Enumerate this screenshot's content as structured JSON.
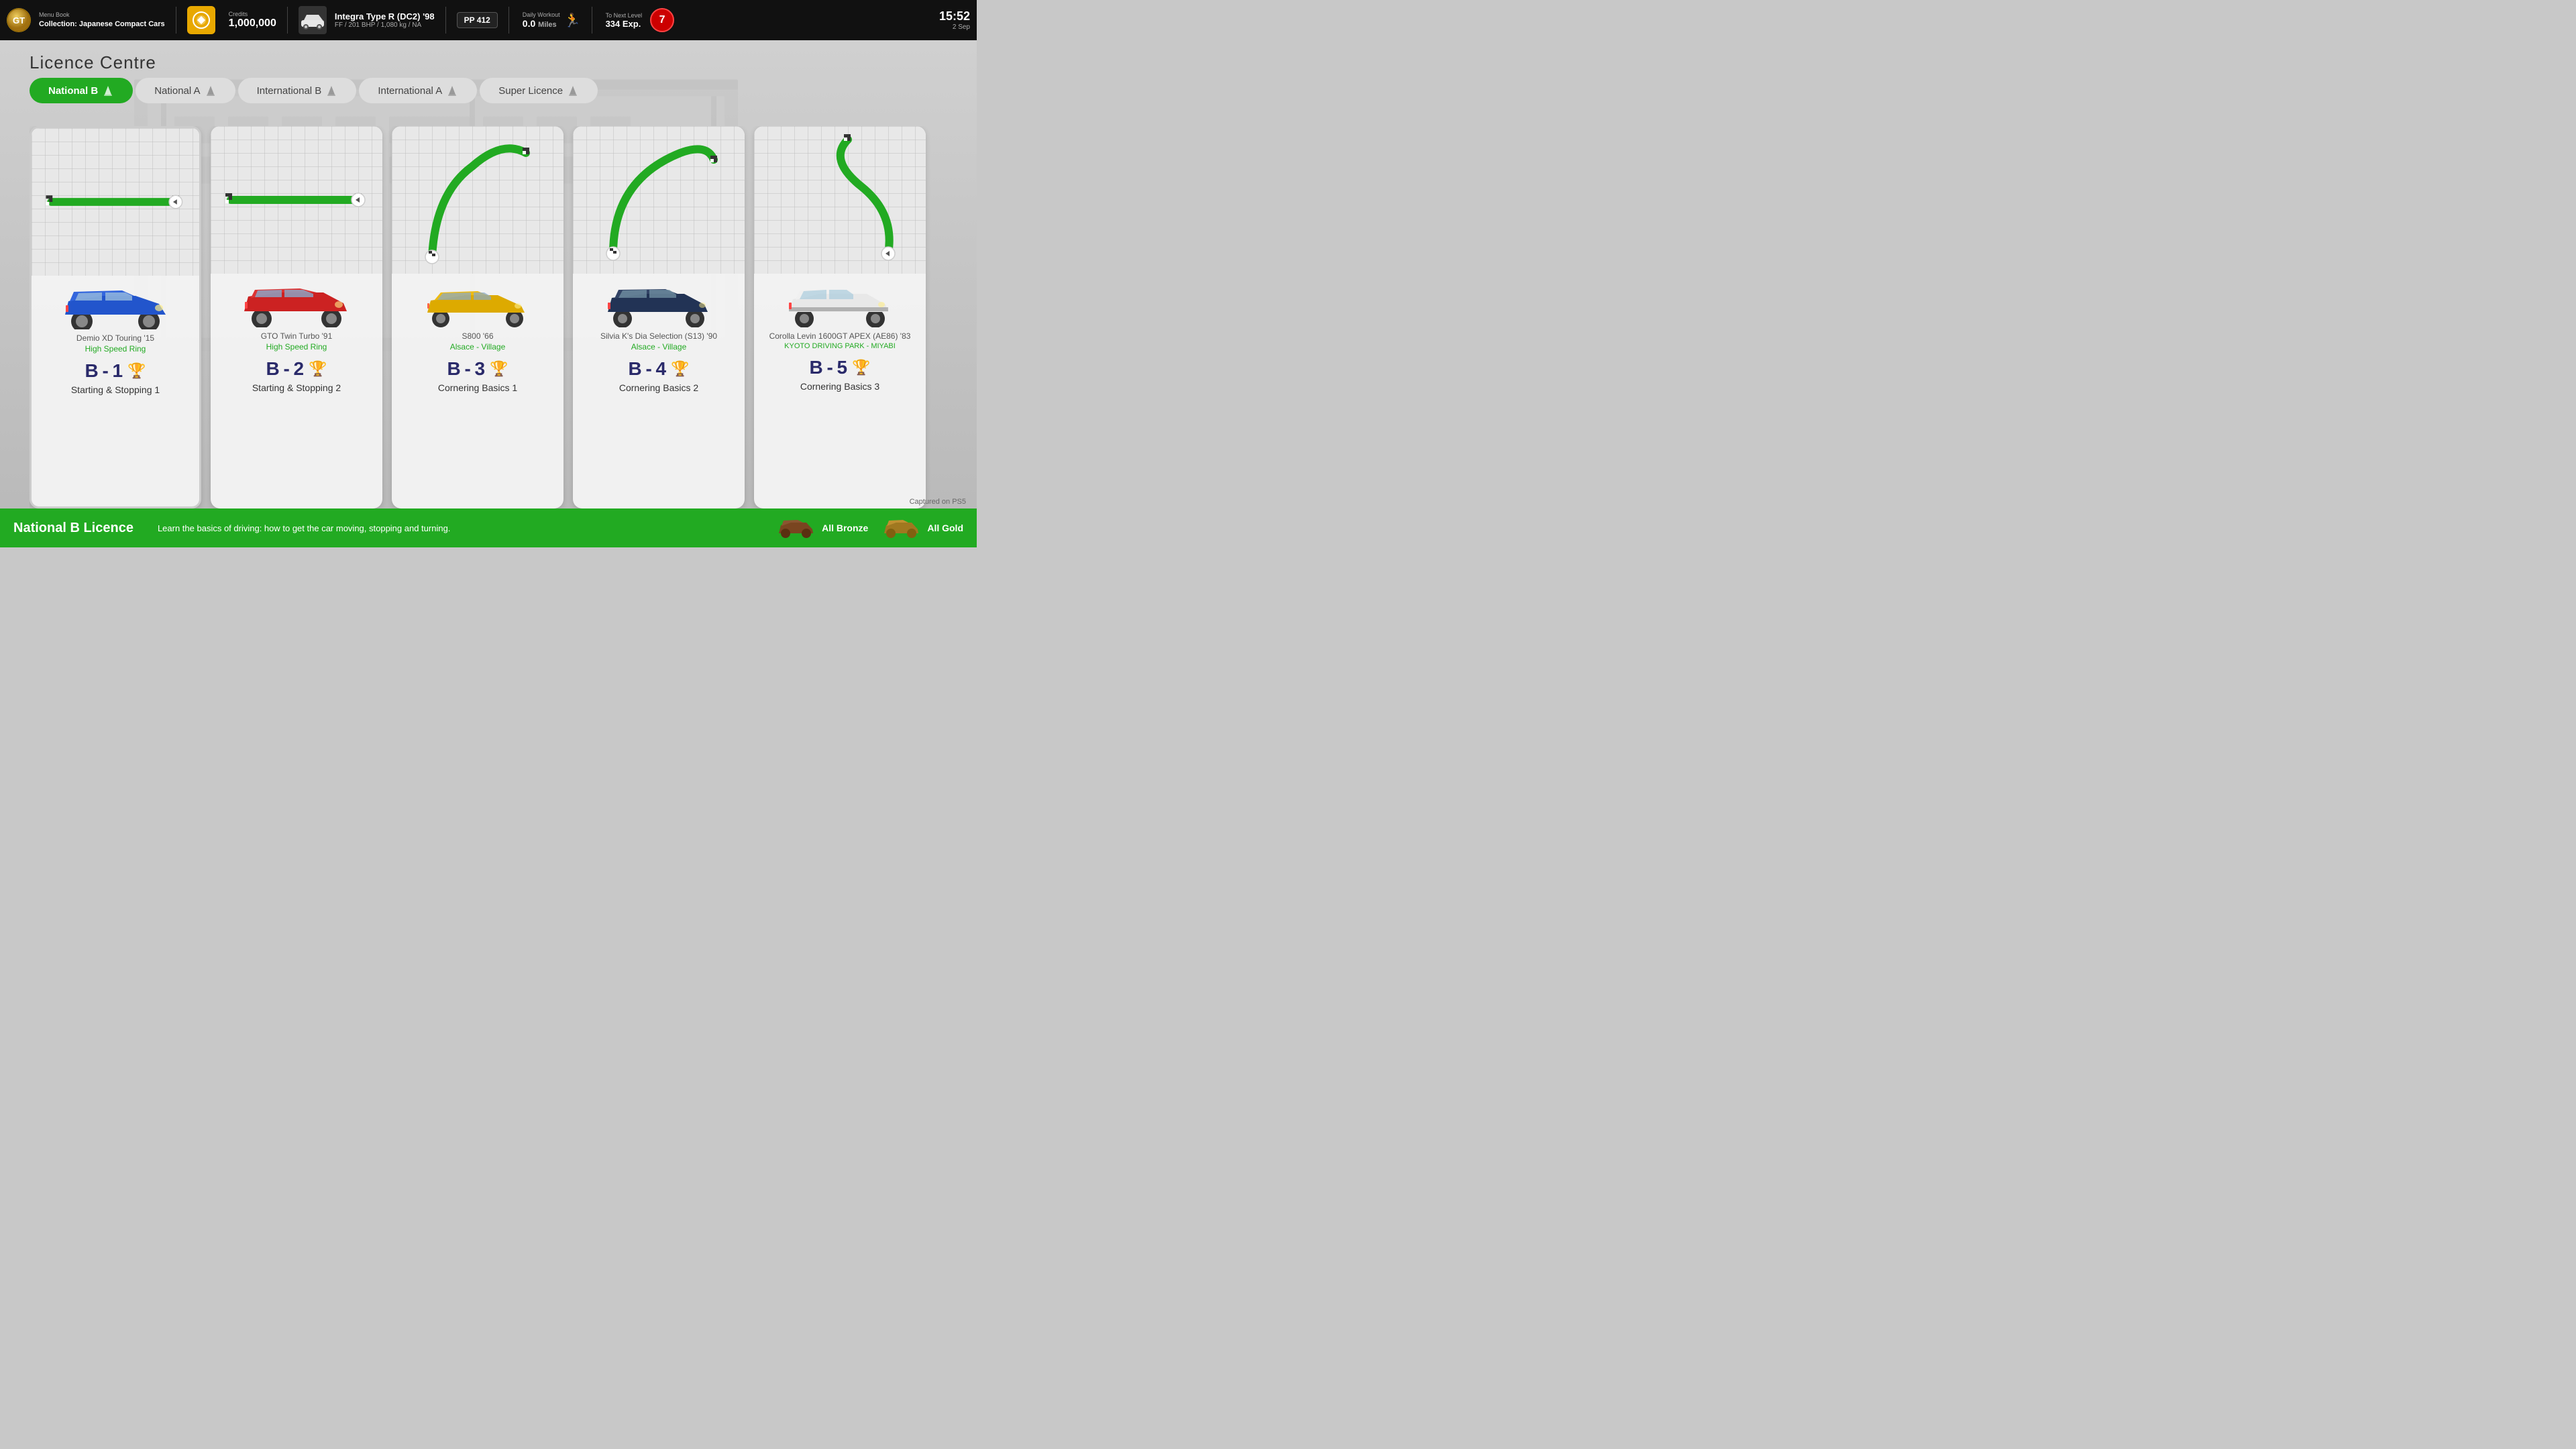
{
  "topbar": {
    "logo": "GT",
    "menu_label": "Menu Book",
    "collection": "Collection: Japanese Compact Cars",
    "credits_label": "Credits",
    "credits_amount": "1,000,000",
    "car_name": "Integra Type R (DC2) '98",
    "car_spec": "FF / 201 BHP / 1,080 kg / NA",
    "pp_label": "PP",
    "pp_value": "412",
    "workout_label": "Daily Workout",
    "workout_value": "0.0",
    "workout_unit": "Miles",
    "next_level_label": "To Next Level",
    "next_level_value": "334 Exp.",
    "level_number": "7",
    "time": "15:52",
    "date": "2 Sep"
  },
  "page": {
    "title": "Licence Centre"
  },
  "tabs": [
    {
      "label": "National B",
      "active": true,
      "cone": true
    },
    {
      "label": "National A",
      "active": false,
      "cone": true
    },
    {
      "label": "International B",
      "active": false,
      "cone": true
    },
    {
      "label": "International A",
      "active": false,
      "cone": true
    },
    {
      "label": "Super Licence",
      "active": false,
      "cone": true
    }
  ],
  "cards": [
    {
      "id": "B-1",
      "car": "Demio XD Touring '15",
      "track": "High Speed Ring",
      "lesson_name": "Starting & Stopping 1",
      "trophy": "silver",
      "track_type": "straight"
    },
    {
      "id": "B-2",
      "car": "GTO Twin Turbo '91",
      "track": "High Speed Ring",
      "lesson_name": "Starting & Stopping 2",
      "trophy": "bronze",
      "track_type": "straight"
    },
    {
      "id": "B-3",
      "car": "S800 '66",
      "track": "Alsace - Village",
      "lesson_name": "Cornering Basics 1",
      "trophy": "gold",
      "track_type": "curve_right"
    },
    {
      "id": "B-4",
      "car": "Silvia K's Dia Selection (S13) '90",
      "track": "Alsace - Village",
      "lesson_name": "Cornering Basics 2",
      "trophy": "silver",
      "track_type": "curve_left"
    },
    {
      "id": "B-5",
      "car": "Corolla Levin 1600GT APEX (AE86) '83",
      "track": "KYOTO DRIVING PARK - MIYABI",
      "track_color": "#22aa22",
      "lesson_name": "Cornering Basics 3",
      "trophy": "silver",
      "track_type": "s_curve"
    }
  ],
  "bottom": {
    "title": "National B Licence",
    "description": "Learn the basics of driving: how to get the car moving, stopping and turning.",
    "award_bronze": "All Bronze",
    "award_gold": "All Gold",
    "captured": "Captured on PS5"
  }
}
